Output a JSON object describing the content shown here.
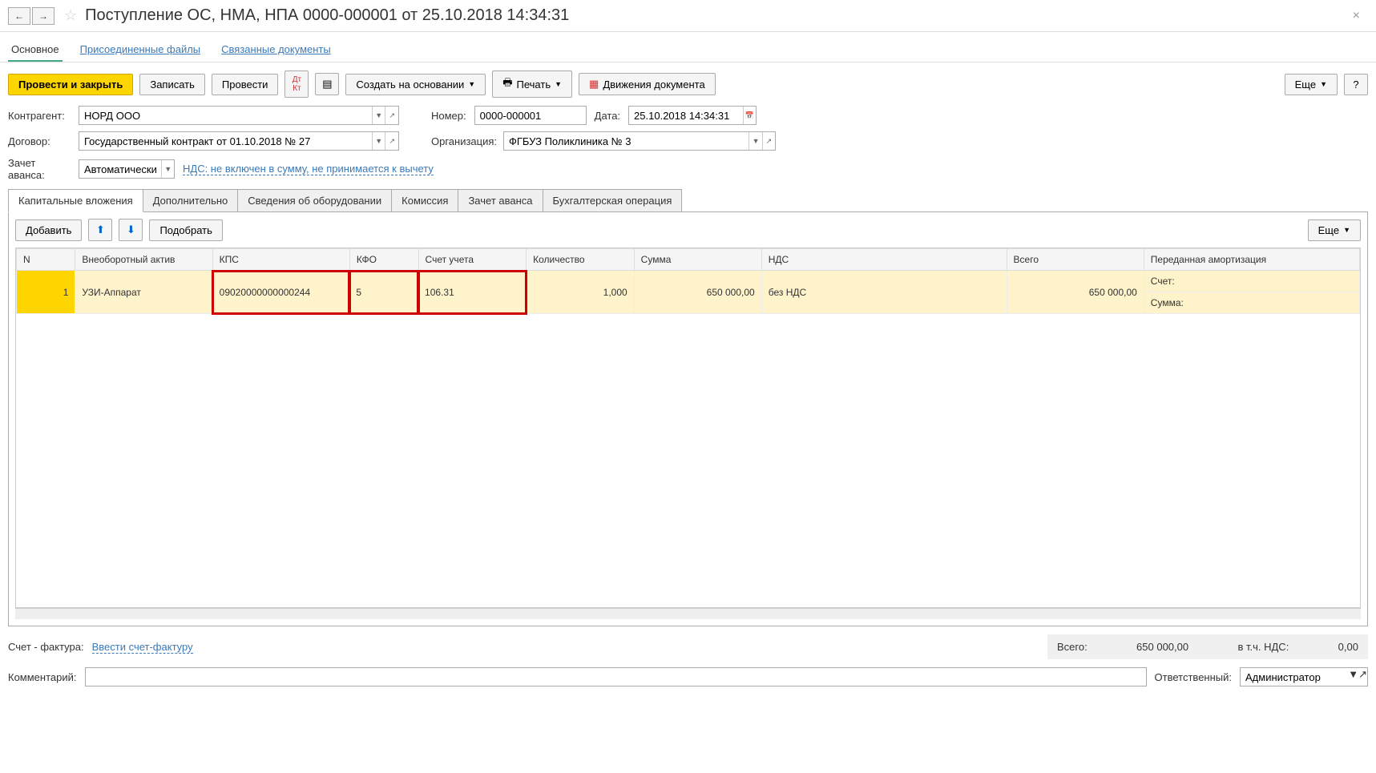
{
  "header": {
    "title": "Поступление ОС, НМА, НПА 0000-000001 от 25.10.2018 14:34:31"
  },
  "navtabs": {
    "main": "Основное",
    "files": "Присоединенные файлы",
    "related": "Связанные документы"
  },
  "toolbar": {
    "post_close": "Провести и закрыть",
    "save": "Записать",
    "post": "Провести",
    "create_based": "Создать на основании",
    "print": "Печать",
    "movements": "Движения документа",
    "more": "Еще"
  },
  "form": {
    "counterparty_label": "Контрагент:",
    "counterparty_value": "НОРД ООО",
    "contract_label": "Договор:",
    "contract_value": "Государственный контракт от 01.10.2018 № 27",
    "advance_label": "Зачет аванса:",
    "advance_value": "Автоматически",
    "vat_link": "НДС: не включен в сумму, не принимается к вычету",
    "number_label": "Номер:",
    "number_value": "0000-000001",
    "date_label": "Дата:",
    "date_value": "25.10.2018 14:34:31",
    "org_label": "Организация:",
    "org_value": "ФГБУЗ Поликлиника № 3"
  },
  "tabs": {
    "capital": "Капитальные вложения",
    "additional": "Дополнительно",
    "equipment": "Сведения об оборудовании",
    "commission": "Комиссия",
    "advance": "Зачет аванса",
    "accounting": "Бухгалтерская операция"
  },
  "tab_toolbar": {
    "add": "Добавить",
    "select": "Подобрать",
    "more": "Еще"
  },
  "grid": {
    "headers": {
      "n": "N",
      "asset": "Внеоборотный актив",
      "kps": "КПС",
      "kfo": "КФО",
      "account": "Счет учета",
      "quantity": "Количество",
      "sum": "Сумма",
      "vat": "НДС",
      "total": "Всего",
      "transferred": "Переданная амортизация"
    },
    "rows": [
      {
        "n": "1",
        "asset": "УЗИ-Аппарат",
        "kps": "09020000000000244",
        "kfo": "5",
        "account": "106.31",
        "quantity": "1,000",
        "sum": "650 000,00",
        "vat": "без НДС",
        "total": "650 000,00",
        "acct_label": "Счет:",
        "sum_label": "Сумма:"
      }
    ]
  },
  "footer": {
    "invoice_label": "Счет - фактура:",
    "invoice_link": "Ввести счет-фактуру",
    "total_label": "Всего:",
    "total_value": "650 000,00",
    "vat_incl_label": "в т.ч. НДС:",
    "vat_incl_value": "0,00",
    "comment_label": "Комментарий:",
    "comment_value": "",
    "responsible_label": "Ответственный:",
    "responsible_value": "Администратор"
  }
}
